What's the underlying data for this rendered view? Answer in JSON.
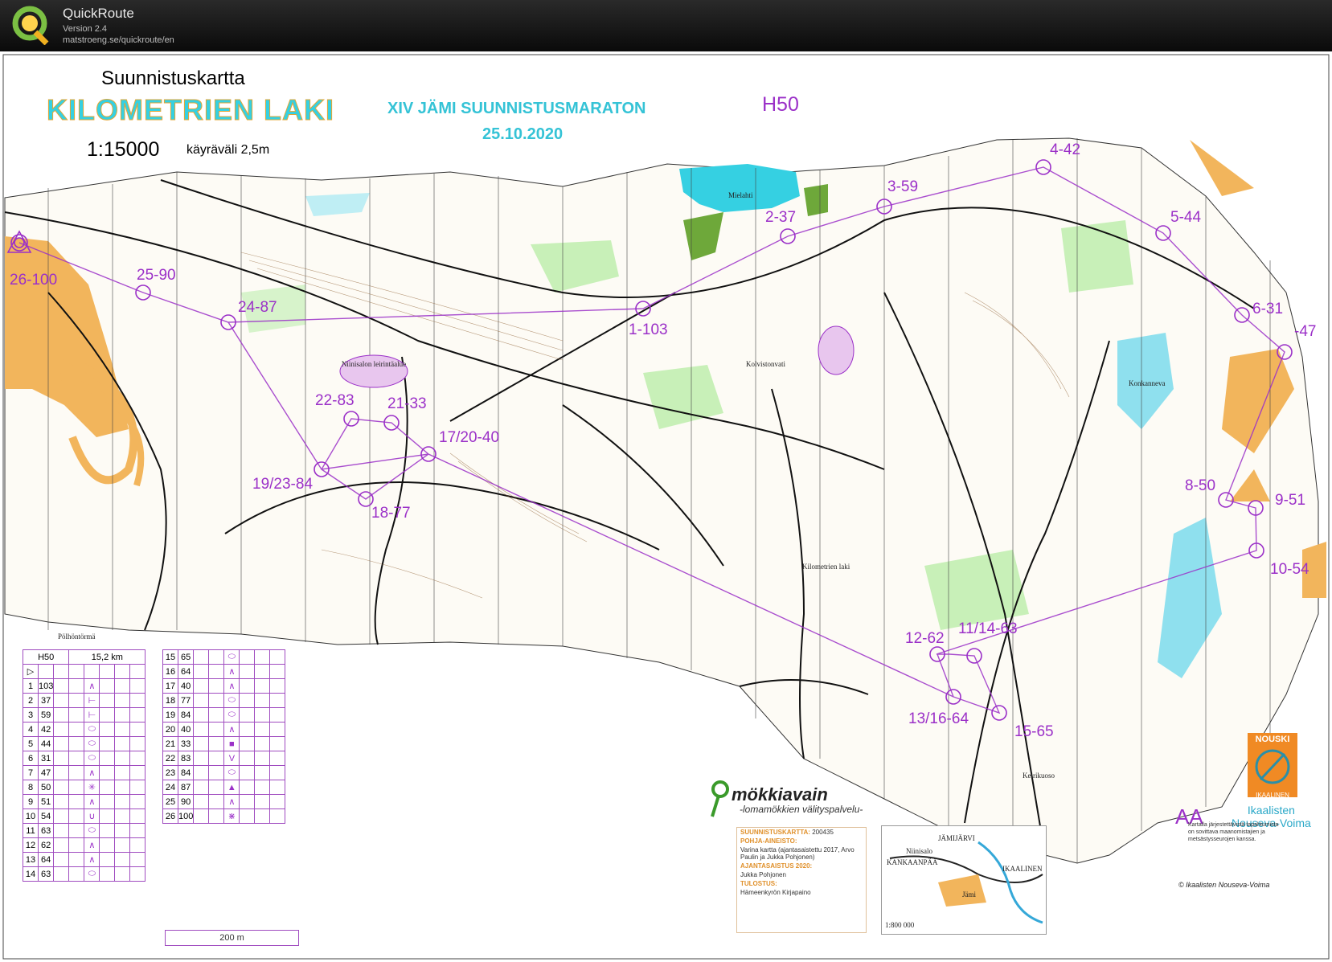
{
  "app": {
    "name": "QuickRoute",
    "version": "Version 2.4",
    "url": "matstroeng.se/quickroute/en"
  },
  "map": {
    "type": "Suunnistuskartta",
    "name": "KILOMETRIEN LAKI",
    "scale": "1:15000",
    "contour_interval": "käyräväli 2,5m",
    "event": "XIV JÄMI SUUNNISTUSMARATON",
    "date": "25.10.2020",
    "course": "H50",
    "place_names": {
      "lake": "Mielahti",
      "camp": "Niinisalon leirintäalue",
      "kolvisto": "Kolvistonvati",
      "konkanneva": "Konkanneva",
      "kilometrien": "Kilometrien laki",
      "pohjola": "Pölhöntörmä",
      "keirikuoso": "Keirikuoso"
    }
  },
  "controls": [
    {
      "label": "26-100"
    },
    {
      "label": "25-90"
    },
    {
      "label": "24-87"
    },
    {
      "label": "1-103"
    },
    {
      "label": "2-37"
    },
    {
      "label": "3-59"
    },
    {
      "label": "4-42"
    },
    {
      "label": "5-44"
    },
    {
      "label": "6-31"
    },
    {
      "label": "-47"
    },
    {
      "label": "8-50"
    },
    {
      "label": "9-51"
    },
    {
      "label": "10-54"
    },
    {
      "label": "11/14-63"
    },
    {
      "label": "12-62"
    },
    {
      "label": "13/16-64"
    },
    {
      "label": "15-65"
    },
    {
      "label": "17/20-40"
    },
    {
      "label": "18-77"
    },
    {
      "label": "19/23-84"
    },
    {
      "label": "21-33"
    },
    {
      "label": "22-83"
    }
  ],
  "description_sheet": {
    "course": "H50",
    "length": "15,2 km",
    "start_symbol": "▷",
    "rows_left": [
      {
        "n": "1",
        "code": "103",
        "s": "∧"
      },
      {
        "n": "2",
        "code": "37",
        "s": "⊢"
      },
      {
        "n": "3",
        "code": "59",
        "s": "⊢"
      },
      {
        "n": "4",
        "code": "42",
        "s": "⬭"
      },
      {
        "n": "5",
        "code": "44",
        "s": "⬭"
      },
      {
        "n": "6",
        "code": "31",
        "s": "⬭"
      },
      {
        "n": "7",
        "code": "47",
        "s": "∧"
      },
      {
        "n": "8",
        "code": "50",
        "s": "✳"
      },
      {
        "n": "9",
        "code": "51",
        "s": "∧"
      },
      {
        "n": "10",
        "code": "54",
        "s": "∪"
      },
      {
        "n": "11",
        "code": "63",
        "s": "⬭"
      },
      {
        "n": "12",
        "code": "62",
        "s": "∧"
      },
      {
        "n": "13",
        "code": "64",
        "s": "∧"
      },
      {
        "n": "14",
        "code": "63",
        "s": "⬭"
      }
    ],
    "rows_right": [
      {
        "n": "15",
        "code": "65",
        "s": "⬭"
      },
      {
        "n": "16",
        "code": "64",
        "s": "∧"
      },
      {
        "n": "17",
        "code": "40",
        "s": "∧"
      },
      {
        "n": "18",
        "code": "77",
        "s": "⬭"
      },
      {
        "n": "19",
        "code": "84",
        "s": "⬭"
      },
      {
        "n": "20",
        "code": "40",
        "s": "∧"
      },
      {
        "n": "21",
        "code": "33",
        "s": "■"
      },
      {
        "n": "22",
        "code": "83",
        "s": "V"
      },
      {
        "n": "23",
        "code": "84",
        "s": "⬭"
      },
      {
        "n": "24",
        "code": "87",
        "s": "▲"
      },
      {
        "n": "25",
        "code": "90",
        "s": "∧"
      },
      {
        "n": "26",
        "code": "100",
        "s": "⋇"
      }
    ],
    "finish_distance": "200 m"
  },
  "sponsors": {
    "mokki_brand": "mökkiavain",
    "mokki_tagline": "-lomamökkien välityspalvelu-",
    "club_logo_text": "NOUSKI",
    "club_logo_sub": "IKAALINEN",
    "club_name_line1": "Ikaalisten",
    "club_name_line2": "Nouseva-Voima"
  },
  "info_box": {
    "map_label": "SUUNNISTUSKARTTA:",
    "map_number": "200435",
    "basis_head": "POHJA-AINEISTO:",
    "basis_text": "Varina kartta (ajantasaistettu 2017, Arvo Paulin ja Jukka Pohjonen)",
    "update_head": "AJANTASAISTUS 2020:",
    "update_text": "Jukka Pohjonen",
    "print_head": "TULOSTUS:",
    "print_text": "Hämeenkyrön Kirjapaino"
  },
  "minimap": {
    "label1": "JÄMIJÄRVI",
    "label2": "KANKAANPÄÄ",
    "label3": "IKAALINEN",
    "label4": "Jämi",
    "label5": "Niinisalo",
    "scale": "1:800 000"
  },
  "footer": {
    "aa": "AA",
    "permission": "Kartalla järjestettävistä tapahtumista on sovittava maanomistajien ja metsästysseurojen kanssa.",
    "copyright": "© Ikaalisten Nouseva-Voima"
  },
  "colors": {
    "course": "#9b30c8",
    "water": "#35d0e2",
    "open_land": "#f2b55c",
    "forest_green": "#8fdc7a"
  }
}
